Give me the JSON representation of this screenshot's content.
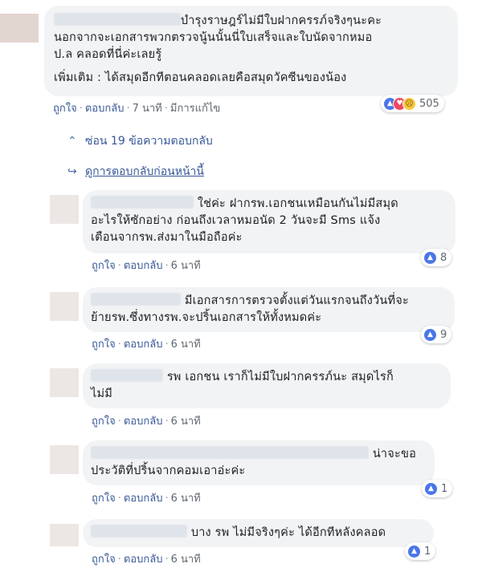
{
  "main_comment": {
    "name_suffix": "บำรุงราษฎร์ไม่มีใบฝากครรภ์จริงๆนะคะ",
    "line2": "นอกจากจะเอกสารพวกตรวจนู้นนั้นนี่ใบเสร็จและใบนัดจากหมอ",
    "line3": "ป.ล คลอดที่นี่ค่ะเลยรู้",
    "line4": "เพิ่มเติม : ได้สมุดอีกทีตอนคลอดเลยคือสมุดวัคซีนของน้อง",
    "like": "ถูกใจ",
    "reply": "ตอบกลับ",
    "time": "7 นาที",
    "edited": "มีการแก้ไข",
    "reaction_count": "505",
    "reaction_icons": [
      "like-icon",
      "love-icon",
      "sad-icon"
    ]
  },
  "hidden_replies": {
    "label": "ซ่อน 19 ข้อความตอบกลับ",
    "icon": "chevron-up-icon"
  },
  "previous_replies": {
    "label": "ดูการตอบกลับก่อนหน้านี้",
    "icon": "reply-arrow-icon"
  },
  "replies": [
    {
      "lines": [
        "ใช่ค่ะ ฝากรพ.เอกชนเหมือนกันไม่มีสมุด",
        "อะไรให้ซักอย่าง ก่อนถึงเวลาหมอนัด 2 วันจะมี Sms แจ้ง",
        "เตือนจากรพ.ส่งมาในมือถือค่ะ"
      ],
      "like": "ถูกใจ",
      "reply": "ตอบกลับ",
      "time": "6 นาที",
      "reaction_count": "8"
    },
    {
      "lines": [
        "มีเอกสารการตรวจตั้งแต่วันแรกจนถึงวันที่จะ",
        "ย้ายรพ.ซึ่งทางรพ.จะปริ้นเอกสารให้ทั้งหมดค่ะ"
      ],
      "like": "ถูกใจ",
      "reply": "ตอบกลับ",
      "time": "6 นาที",
      "reaction_count": "9"
    },
    {
      "lines": [
        "รพ เอกชน เราก็ไม่มีใบฝากครรภ์นะ สมุดไรก็",
        "ไม่มี"
      ],
      "like": "ถูกใจ",
      "reply": "ตอบกลับ",
      "time": "6 นาที",
      "reaction_count": ""
    },
    {
      "lines": [
        "น่าจะขอ",
        "ประวัติที่ปริ้นจากคอมเอาอ่ะค่ะ"
      ],
      "like": "ถูกใจ",
      "reply": "ตอบกลับ",
      "time": "6 นาที",
      "reaction_count": "1"
    },
    {
      "lines": [
        "บาง รพ ไม่มีจริงๆค่ะ ได้อีกทีหลังคลอด"
      ],
      "like": "ถูกใจ",
      "reply": "ตอบกลับ",
      "time": "6 นาที",
      "reaction_count": "1"
    }
  ],
  "colors": {
    "link": "#385898",
    "bubble": "#f2f3f5",
    "meta": "#606770",
    "like": "#4a76e8",
    "love": "#f0475e",
    "sad": "#f7c843"
  }
}
